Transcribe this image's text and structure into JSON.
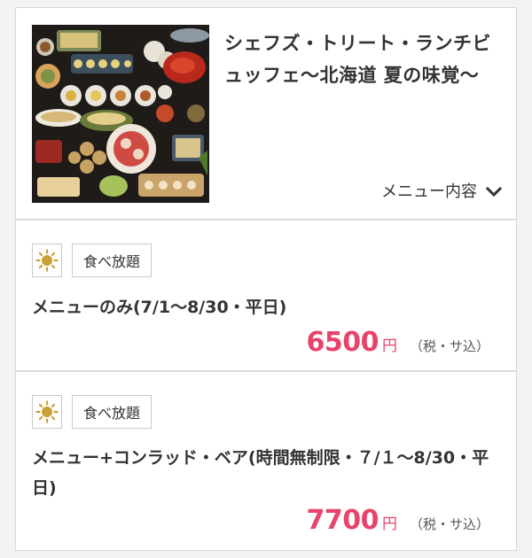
{
  "header": {
    "title": "シェフズ・トリート・ランチビュッフェ〜北海道 夏の味覚〜",
    "menu_toggle_label": "メニュー内容"
  },
  "plans": [
    {
      "badge_label": "食べ放題",
      "name": "メニューのみ(7/1〜8/30・平日)",
      "price": "6500",
      "currency": "円",
      "tax_note": "（税・サ込）"
    },
    {
      "badge_label": "食べ放題",
      "name": "メニュー+コンラッド・ベア(時間無制限・７/１〜8/30・平日)",
      "price": "7700",
      "currency": "円",
      "tax_note": "（税・サ込）"
    }
  ],
  "colors": {
    "price": "#e8436a",
    "sun_icon": "#c8a036"
  },
  "icons": [
    "sun-icon",
    "chevron-down-icon"
  ]
}
